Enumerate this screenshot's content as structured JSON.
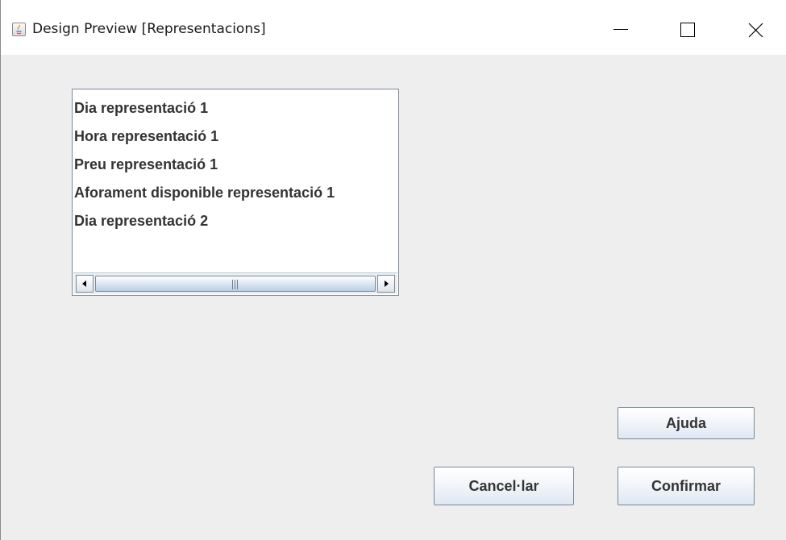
{
  "window": {
    "title": "Design Preview [Representacions]",
    "icon": "java-icon",
    "controls": [
      "minimize-icon",
      "maximize-icon",
      "close-icon"
    ]
  },
  "list": {
    "items": [
      "Dia representació 1",
      "Hora representació 1",
      "Preu representació 1",
      "Aforament disponible representació 1",
      "Dia representació 2"
    ]
  },
  "buttons": {
    "help": "Ajuda",
    "cancel": "Cancel·lar",
    "confirm": "Confirmar"
  },
  "colors": {
    "window_background": "#eeeeee",
    "titlebar_background": "#ffffff",
    "list_background": "#ffffff",
    "text": "#333333",
    "button_border": "#7a8a99",
    "button_gradient_bottom": "#dde8f3"
  }
}
